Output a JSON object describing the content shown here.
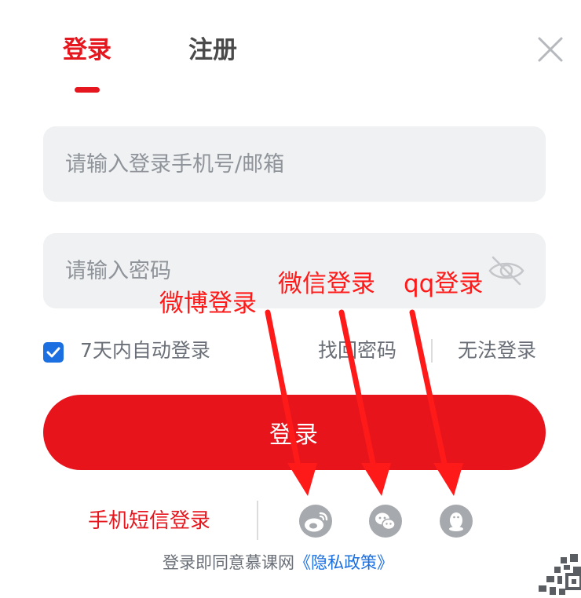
{
  "tabs": {
    "login": "登录",
    "register": "注册"
  },
  "icons": {
    "close": "close-icon",
    "eye": "eye-off-icon",
    "weibo": "weibo-icon",
    "wechat": "wechat-icon",
    "qq": "qq-icon",
    "checkbox": "checkbox-checked-icon"
  },
  "form": {
    "phone_placeholder": "请输入登录手机号/邮箱",
    "password_placeholder": "请输入密码",
    "remember_label": "7天内自动登录",
    "remember_checked": true,
    "find_password": "找回密码",
    "cannot_login": "无法登录",
    "submit_label": "登录"
  },
  "alt_login": {
    "sms_label": "手机短信登录"
  },
  "agreement": {
    "prefix": "登录即同意慕课网",
    "policy_link": "《隐私政策》"
  },
  "annotations": {
    "weibo": "微博登录",
    "wechat": "微信登录",
    "qq": "qq登录"
  },
  "colors": {
    "brand_red": "#e6161e",
    "button_red": "#e8141c",
    "link_blue": "#1c6fe0",
    "annotation_red": "#ff1a1a",
    "icon_gray": "#a6a9ad",
    "field_bg": "#f0f1f2"
  }
}
